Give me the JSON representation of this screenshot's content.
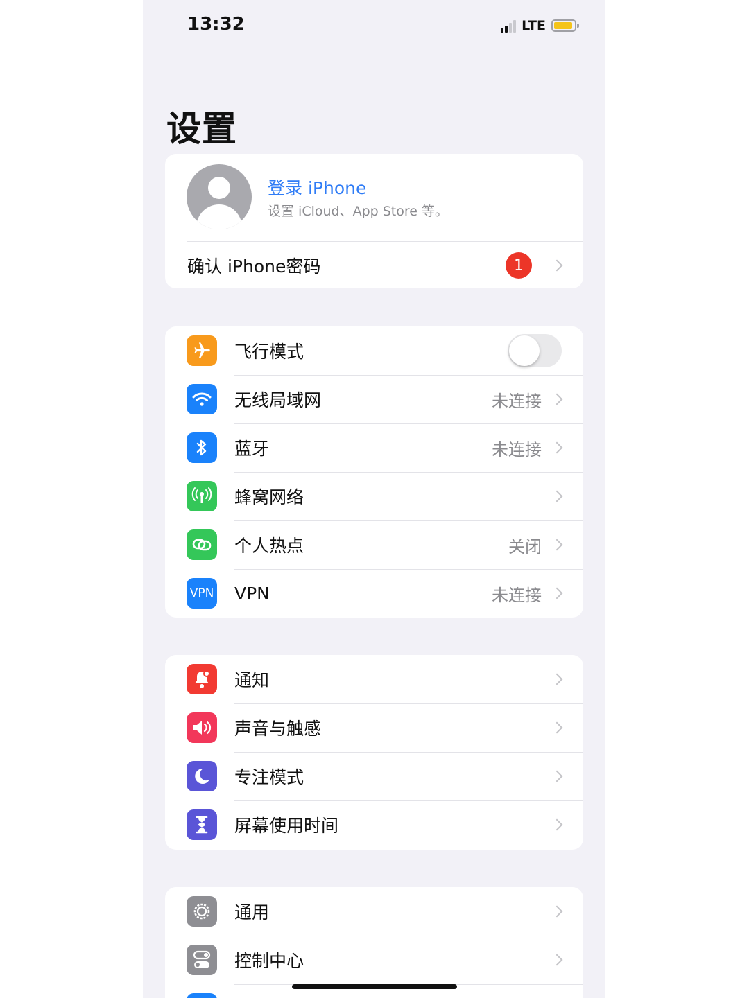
{
  "status_bar": {
    "time": "13:32",
    "network": "LTE",
    "battery_level": 0.85,
    "battery_color": "#f5c419"
  },
  "header": {
    "title": "设置"
  },
  "account": {
    "name": "登录 iPhone",
    "subtitle": "设置 iCloud、App Store 等。",
    "confirm_label": "确认 iPhone密码",
    "badge": "1"
  },
  "connectivity": [
    {
      "label": "飞行模式",
      "icon": "airplane-icon",
      "color": "#f89a1c",
      "toggle": false
    },
    {
      "label": "无线局域网",
      "icon": "wifi-icon",
      "color": "#1a82fb",
      "value": "未连接"
    },
    {
      "label": "蓝牙",
      "icon": "bluetooth-icon",
      "color": "#1a82fb",
      "value": "未连接"
    },
    {
      "label": "蜂窝网络",
      "icon": "cellular-icon",
      "color": "#34c759",
      "value": ""
    },
    {
      "label": "个人热点",
      "icon": "hotspot-icon",
      "color": "#34c759",
      "value": "关闭"
    },
    {
      "label": "VPN",
      "icon": "vpn-icon",
      "icon_text": "VPN",
      "color": "#1a82fb",
      "value": "未连接"
    }
  ],
  "notifications_group": [
    {
      "label": "通知",
      "icon": "bell-icon",
      "color": "#f23a32"
    },
    {
      "label": "声音与触感",
      "icon": "speaker-icon",
      "color": "#f2375a"
    },
    {
      "label": "专注模式",
      "icon": "moon-icon",
      "color": "#5a55d7"
    },
    {
      "label": "屏幕使用时间",
      "icon": "hourglass-icon",
      "color": "#5a55d7"
    }
  ],
  "general_group": [
    {
      "label": "通用",
      "icon": "gear-icon",
      "color": "#8e8e93"
    },
    {
      "label": "控制中心",
      "icon": "control-center-icon",
      "color": "#8e8e93"
    }
  ]
}
